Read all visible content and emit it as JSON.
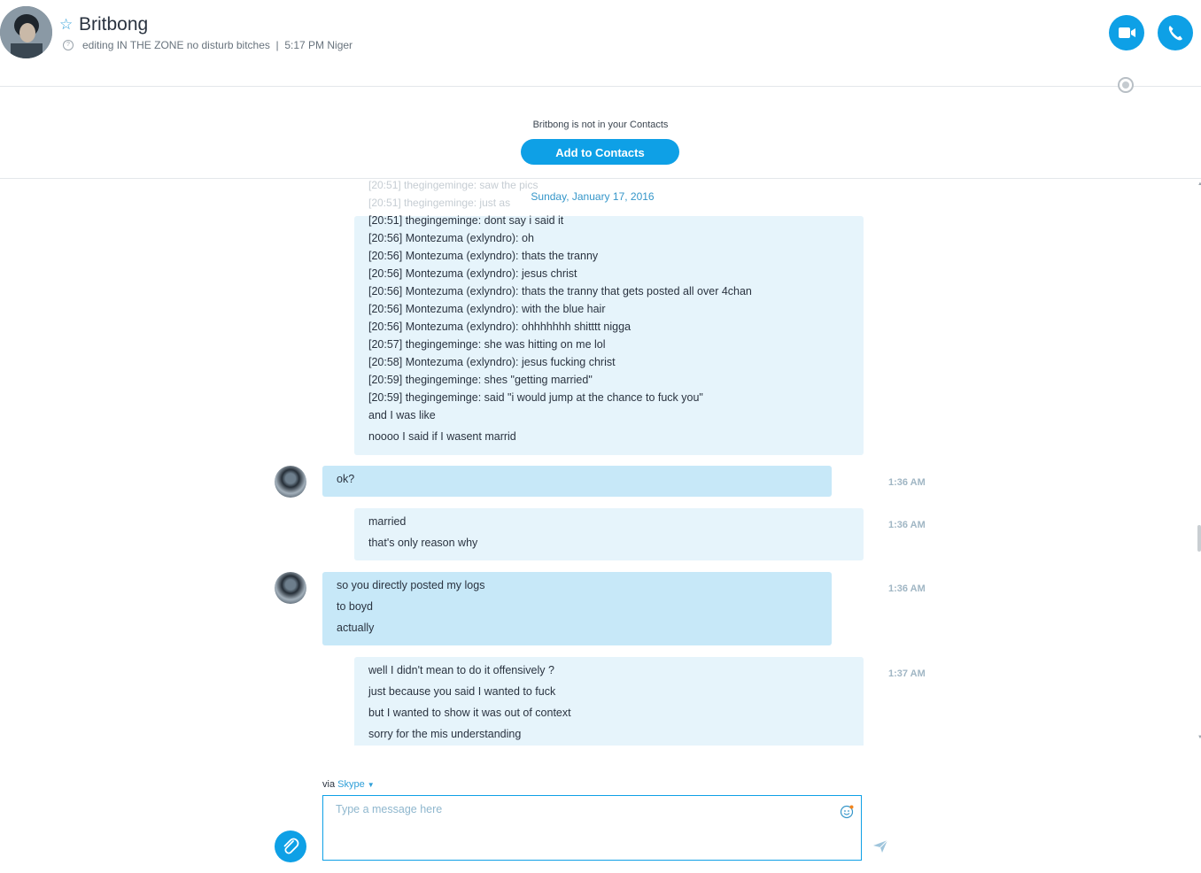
{
  "header": {
    "contact_name": "Britbong",
    "mood": "editing IN THE ZONE no disturb bitches",
    "separator": "|",
    "local_time": "5:17 PM Niger",
    "star_glyph": "☆",
    "icons": {
      "video": "video-call-icon",
      "audio": "audio-call-icon",
      "globe": "globe-icon",
      "status": "question-status-icon"
    }
  },
  "notice": {
    "text": "Britbong is not in your Contacts",
    "add_label": "Add to Contacts"
  },
  "chat": {
    "faded_lines": [
      "[20:51] thegingeminge: saw the pics",
      "[20:51] thegingeminge: just as"
    ],
    "date": "Sunday, January 17, 2016",
    "log_block": [
      "[20:51] thegingeminge: dont say i said it",
      "[20:56] Montezuma (exlyndro): oh",
      "[20:56] Montezuma (exlyndro): thats the tranny",
      "[20:56] Montezuma (exlyndro): jesus christ",
      "[20:56] Montezuma (exlyndro): thats the tranny that gets posted all over 4chan",
      "[20:56] Montezuma (exlyndro): with the blue hair",
      "[20:56] Montezuma (exlyndro): ohhhhhhh shitttt nigga",
      "[20:57] thegingeminge: she was hitting on me lol",
      "[20:58] Montezuma (exlyndro): jesus fucking christ",
      "[20:59] thegingeminge: shes \"getting married\"",
      "[20:59] thegingeminge: said \"i would jump at the chance to fuck you\""
    ],
    "log_tail": [
      "and I was like",
      "noooo I said if I wasent marrid"
    ],
    "messages": [
      {
        "sender": "me",
        "lines": [
          "ok?"
        ],
        "time": "1:36 AM"
      },
      {
        "sender": "them",
        "lines": [
          "married",
          "that's only reason why"
        ],
        "time": "1:36 AM"
      },
      {
        "sender": "me",
        "lines": [
          "so you directly posted my logs",
          "to boyd",
          "actually"
        ],
        "time": "1:36 AM"
      },
      {
        "sender": "them",
        "lines": [
          "well I didn't mean to do it offensively ?",
          "just because you said I wanted to fuck",
          "but I wanted to show it was out of context",
          "sorry for the mis understanding"
        ],
        "time": "1:37 AM"
      }
    ]
  },
  "composer": {
    "via_label": "via",
    "via_service": "Skype",
    "placeholder": "Type a message here",
    "icons": {
      "attach": "paperclip-icon",
      "emoji": "emoji-icon",
      "send": "send-icon",
      "dropdown": "chevron-down-icon"
    }
  },
  "colors": {
    "accent": "#0ea0e6",
    "bubble_theirs": "#e6f4fb",
    "bubble_mine": "#c7e8f8",
    "time": "#a0b6c4"
  }
}
